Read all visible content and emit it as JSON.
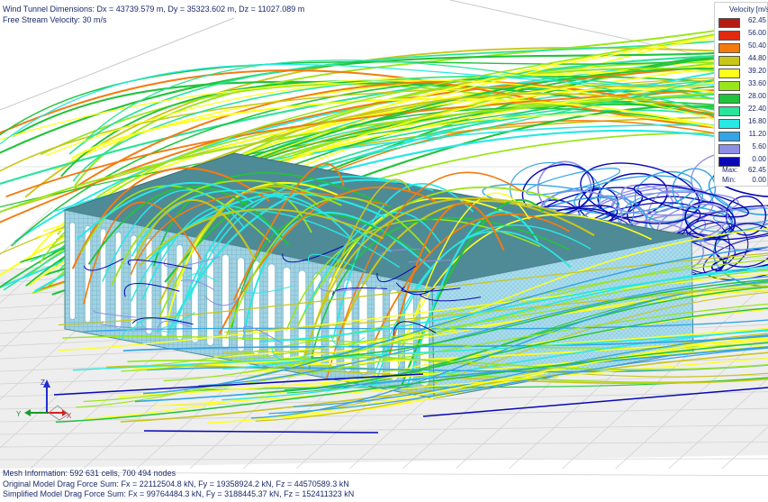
{
  "header": {
    "dimensions": "Wind Tunnel Dimensions: Dx = 43739.579 m, Dy = 35323.602 m, Dz = 11027.089 m",
    "velocity": "Free Stream Velocity: 30 m/s"
  },
  "legend": {
    "title": "Velocity [m/s]",
    "entries": [
      {
        "label": "62.45",
        "color": "#b41b12"
      },
      {
        "label": "56.00",
        "color": "#e02a10"
      },
      {
        "label": "50.40",
        "color": "#f57a0e"
      },
      {
        "label": "44.80",
        "color": "#c9c61a"
      },
      {
        "label": "39.20",
        "color": "#ffff1e"
      },
      {
        "label": "33.60",
        "color": "#99e61a"
      },
      {
        "label": "28.00",
        "color": "#20c43a"
      },
      {
        "label": "22.40",
        "color": "#2be39a"
      },
      {
        "label": "16.80",
        "color": "#26e8e4"
      },
      {
        "label": "11.20",
        "color": "#34a4e6"
      },
      {
        "label": "5.60",
        "color": "#8e8ee6"
      },
      {
        "label": "0.00",
        "color": "#0808b4"
      }
    ],
    "max_label": "Max:",
    "max_value": "62.45",
    "min_label": "Min:",
    "min_value": "0.00"
  },
  "footer": {
    "mesh": "Mesh Information: 592 631 cells, 700 494 nodes",
    "original": "Original Model Drag Force Sum: Fx = 22112504.8 kN, Fy = 19358924.2 kN, Fz = 44570589.3 kN",
    "simplified": "Simplified Model Drag Force Sum: Fx = 99764484.3 kN, Fy = 3188445.37 kN, Fz = 152411323 kN"
  },
  "axes": {
    "x": "X",
    "y": "Y",
    "z": "Z"
  },
  "colors": {
    "building_top": "#4f8b96",
    "building_side": "#a6dcec",
    "grid": "#cfcfcf"
  }
}
